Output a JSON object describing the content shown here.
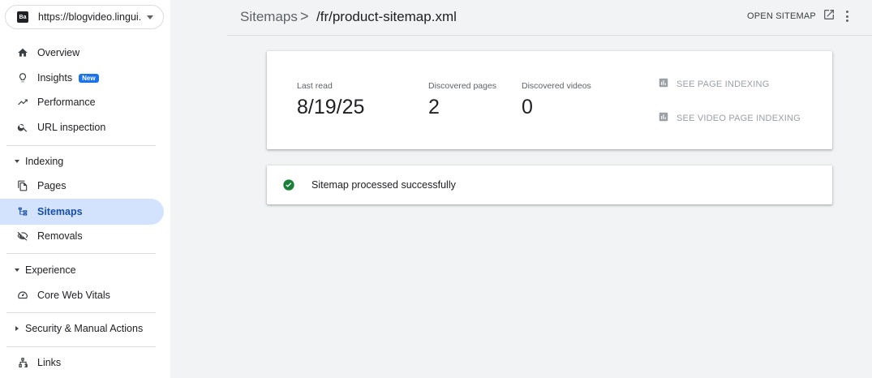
{
  "property": {
    "favicon_text": "Ba",
    "url": "https://blogvideo.lingui..."
  },
  "sidebar": {
    "items_top": [
      {
        "label": "Overview",
        "icon": "home-icon"
      },
      {
        "label": "Insights",
        "icon": "lightbulb-icon",
        "badge": "New"
      },
      {
        "label": "Performance",
        "icon": "trending-up-icon"
      },
      {
        "label": "URL inspection",
        "icon": "search-icon"
      }
    ],
    "sections": [
      {
        "label": "Indexing",
        "expanded": true,
        "items": [
          {
            "label": "Pages",
            "icon": "pages-icon"
          },
          {
            "label": "Sitemaps",
            "icon": "sitemap-icon",
            "active": true
          },
          {
            "label": "Removals",
            "icon": "visibility-off-icon"
          }
        ]
      },
      {
        "label": "Experience",
        "expanded": true,
        "items": [
          {
            "label": "Core Web Vitals",
            "icon": "speed-gauge-icon"
          }
        ]
      },
      {
        "label": "Security & Manual Actions",
        "expanded": false,
        "items": []
      }
    ],
    "items_bottom": [
      {
        "label": "Links",
        "icon": "links-icon"
      }
    ]
  },
  "header": {
    "breadcrumb_root": "Sitemaps",
    "breadcrumb_sep": ">",
    "breadcrumb_current": "/fr/product-sitemap.xml",
    "open_sitemap_label": "OPEN SITEMAP"
  },
  "stats": {
    "last_read_label": "Last read",
    "last_read_value": "8/19/25",
    "discovered_pages_label": "Discovered pages",
    "discovered_pages_value": "2",
    "discovered_videos_label": "Discovered videos",
    "discovered_videos_value": "0",
    "see_page_indexing": "SEE PAGE INDEXING",
    "see_video_page_indexing": "SEE VIDEO PAGE INDEXING"
  },
  "status": {
    "text": "Sitemap processed successfully",
    "color": "#188038"
  },
  "colors": {
    "active_bg": "#d3e3fd",
    "accent": "#1a73e8",
    "success": "#188038"
  }
}
